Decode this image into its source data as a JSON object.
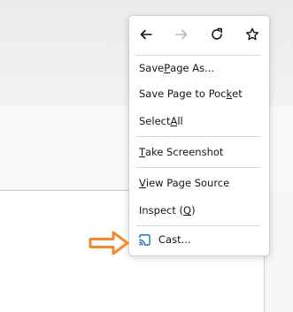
{
  "nav": {
    "back_icon": "arrow-left-icon",
    "forward_icon": "arrow-right-icon",
    "reload_icon": "reload-icon",
    "bookmark_icon": "star-icon"
  },
  "menu": {
    "save_page_as": {
      "pre": "Save ",
      "u": "P",
      "post": "age As..."
    },
    "save_to_pocket": {
      "pre": "Save Page to Poc",
      "u": "k",
      "post": "et"
    },
    "select_all": {
      "pre": "Select ",
      "u": "A",
      "post": "ll"
    },
    "take_screenshot": {
      "pre": "",
      "u": "T",
      "post": "ake Screenshot"
    },
    "view_page_source": {
      "pre": "",
      "u": "V",
      "post": "iew Page Source"
    },
    "inspect": {
      "pre": "Inspect (",
      "u": "Q",
      "post": ")"
    },
    "cast": {
      "label": "Cast...",
      "icon": "cast-icon"
    }
  },
  "annotation": {
    "arrow_icon": "orange-arrow-icon",
    "arrow_color": "#f58a2c"
  },
  "colors": {
    "icon_blue": "#1a73c9",
    "text": "#15141a",
    "disabled": "#b8b8bf"
  }
}
